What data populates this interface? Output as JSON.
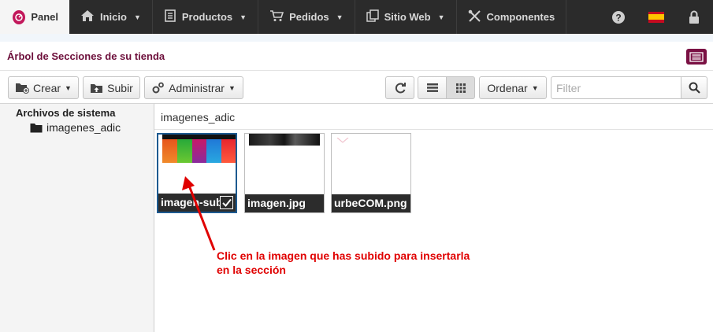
{
  "topnav": {
    "items": [
      {
        "label": "Panel",
        "icon": "dashboard-icon"
      },
      {
        "label": "Inicio",
        "icon": "home-icon"
      },
      {
        "label": "Productos",
        "icon": "book-icon"
      },
      {
        "label": "Pedidos",
        "icon": "cart-icon"
      },
      {
        "label": "Sitio Web",
        "icon": "copy-icon"
      },
      {
        "label": "Componentes",
        "icon": "tools-icon"
      }
    ],
    "right_icons": [
      "help-icon",
      "spanish-flag-icon",
      "lock-icon"
    ]
  },
  "section": {
    "title": "Árbol de Secciones de su tienda"
  },
  "toolbar": {
    "crear": "Crear",
    "subir": "Subir",
    "administrar": "Administrar",
    "ordenar": "Ordenar",
    "filter_placeholder": "Filter"
  },
  "tree": {
    "root": "Archivos de sistema",
    "folder": "imagenes_adic"
  },
  "main": {
    "path": "imagenes_adic",
    "files": [
      {
        "name": "imagen-subi",
        "selected": true
      },
      {
        "name": "imagen.jpg",
        "selected": false
      },
      {
        "name": "urbeCOM.png",
        "selected": false
      }
    ]
  },
  "annotation": {
    "line1": "Clic en la imagen que has subido para insertarla",
    "line2": "en la sección"
  },
  "colors": {
    "nav_bg": "#2b2b2b",
    "title_color": "#6d0f3b",
    "annotation": "#e00000",
    "selection": "#1d5a90"
  }
}
